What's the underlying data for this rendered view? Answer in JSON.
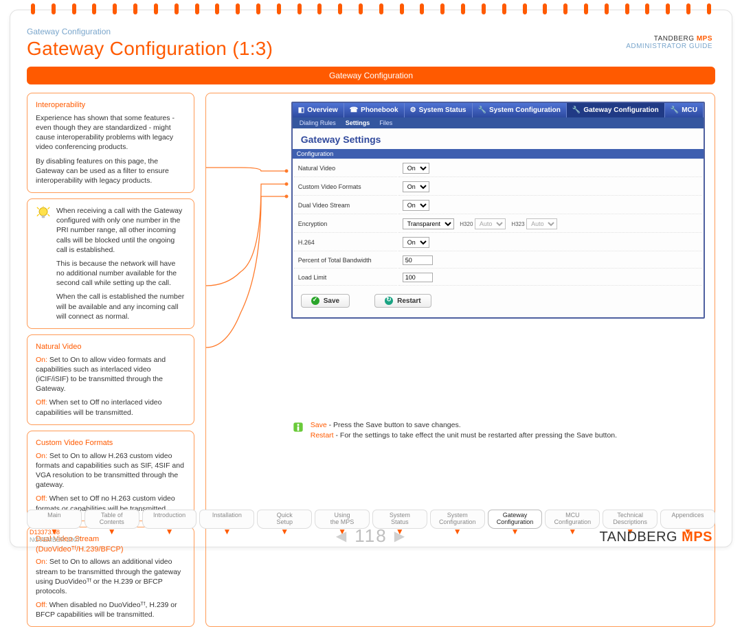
{
  "breadcrumb": "Gateway Configuration",
  "title": "Gateway Configuration (1:3)",
  "header_brand_line1_a": "TANDBERG",
  "header_brand_line1_b": "MPS",
  "header_brand_line2": "ADMINISTRATOR GUIDE",
  "orange_bar": "Gateway Configuration",
  "interop": {
    "heading": "Interoperability",
    "p1": "Experience has shown that some features - even though they are standardized - might cause interoperability problems with legacy video conferencing products.",
    "p2": "By disabling features on this page, the Gateway can be used as a filter to ensure interoperability with legacy products."
  },
  "tip": {
    "p1": "When receiving a call with the Gateway configured with only one number in the PRI number range, all other incoming calls will be blocked until the ongoing call is established.",
    "p2": "This is because the network will have no additional number available for the second call while setting up the call.",
    "p3": "When the call is established the number will be available and any incoming call will connect as normal."
  },
  "natural": {
    "heading": "Natural Video",
    "on_lbl": "On:",
    "on_txt": " Set to On to allow video formats and capabilities such as interlaced video (iCIF/iSIF) to be transmitted through the Gateway.",
    "off_lbl": "Off:",
    "off_txt": " When set to Off no interlaced video capabilities will be transmitted."
  },
  "custom": {
    "heading": "Custom Video Formats",
    "on_lbl": "On:",
    "on_txt": " Set to On to allow H.263 custom video formats and capabilities such as SIF, 4SIF and VGA resolution to be transmitted through the gateway.",
    "off_lbl": "Off:",
    "off_txt": " When set to Off no H.263 custom video formats or capabilities will be transmitted."
  },
  "dual": {
    "heading": "Dual Video Stream (DuoVideoᵀᶠ/H.239/BFCP)",
    "on_lbl": "On:",
    "on_txt": " Set to On to allows an additional video stream to be transmitted through the gateway using DuoVideoᵀᶠ or the H.239 or BFCP protocols.",
    "off_lbl": "Off:",
    "off_txt": " When disabled no DuoVideoᵀᶠ, H.239 or BFCP capabilities will be transmitted."
  },
  "ss": {
    "topnav": [
      "Overview",
      "Phonebook",
      "System Status",
      "System Configuration",
      "Gateway Configuration",
      "MCU"
    ],
    "subnav": [
      "Dialing Rules",
      "Settings",
      "Files"
    ],
    "title": "Gateway Settings",
    "cfg_head": "Configuration",
    "rows": {
      "natural": {
        "label": "Natural Video",
        "val": "On"
      },
      "custom": {
        "label": "Custom Video Formats",
        "val": "On"
      },
      "dual": {
        "label": "Dual Video Stream",
        "val": "On"
      },
      "enc": {
        "label": "Encryption",
        "val": "Transparent",
        "h320l": "H320",
        "h320v": "Auto",
        "h323l": "H323",
        "h323v": "Auto"
      },
      "h264": {
        "label": "H.264",
        "val": "On"
      },
      "pct": {
        "label": "Percent of Total Bandwidth",
        "val": "50"
      },
      "load": {
        "label": "Load Limit",
        "val": "100"
      }
    },
    "save": "Save",
    "restart": "Restart"
  },
  "caption": {
    "save_k": "Save",
    "save_t": " - Press the Save button to save changes.",
    "restart_k": "Restart",
    "restart_t": " - For the settings to take effect the unit must be restarted after pressing the Save button."
  },
  "tabs": [
    "Main",
    "Table of\nContents",
    "Introduction",
    "Installation",
    "Quick\nSetup",
    "Using\nthe MPS",
    "System\nStatus",
    "System\nConfiguration",
    "Gateway\nConfiguration",
    "MCU\nConfiguration",
    "Technical\nDescriptions",
    "Appendices"
  ],
  "active_tab_index": 8,
  "doc_id": "D13373.08",
  "doc_date": "NOVEMBER 2007",
  "page_number": "118",
  "brand_a": "TANDBERG",
  "brand_b": "MPS"
}
